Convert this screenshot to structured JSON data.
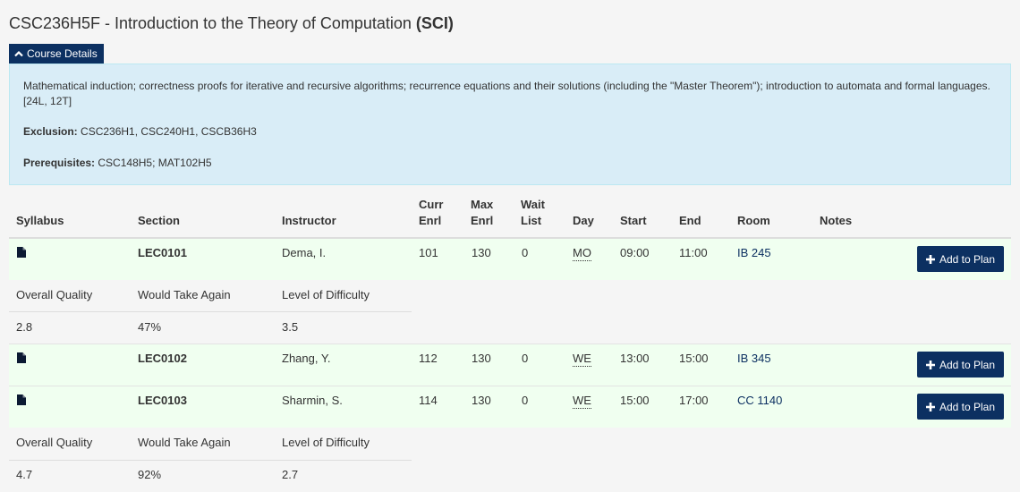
{
  "course": {
    "code_title": "CSC236H5F - Introduction to the Theory of Computation",
    "category": "(SCI)",
    "details_toggle": "Course Details",
    "description": "Mathematical induction; correctness proofs for iterative and recursive algorithms; recurrence equations and their solutions (including the \"Master Theorem\"); introduction to automata and formal languages. [24L, 12T]",
    "exclusion_label": "Exclusion:",
    "exclusion_value": " CSC236H1, CSC240H1, CSCB36H3",
    "prereq_label": "Prerequisites:",
    "prereq_value": " CSC148H5; MAT102H5"
  },
  "table": {
    "headers": {
      "syllabus": "Syllabus",
      "section": "Section",
      "instructor": "Instructor",
      "curr1": "Curr",
      "curr2": "Enrl",
      "max1": "Max",
      "max2": "Enrl",
      "wait1": "Wait",
      "wait2": "List",
      "day": "Day",
      "start": "Start",
      "end": "End",
      "room": "Room",
      "notes": "Notes"
    },
    "add_label": "Add to Plan",
    "rows": [
      {
        "section": "LEC0101",
        "instructor": "Dema, I.",
        "curr": "101",
        "max": "130",
        "wait": "0",
        "day": "MO",
        "start": "09:00",
        "end": "11:00",
        "room": "IB 245"
      },
      {
        "section": "LEC0102",
        "instructor": "Zhang, Y.",
        "curr": "112",
        "max": "130",
        "wait": "0",
        "day": "WE",
        "start": "13:00",
        "end": "15:00",
        "room": "IB 345"
      },
      {
        "section": "LEC0103",
        "instructor": "Sharmin, S.",
        "curr": "114",
        "max": "130",
        "wait": "0",
        "day": "WE",
        "start": "15:00",
        "end": "17:00",
        "room": "CC 1140"
      }
    ],
    "rating_headers": {
      "quality": "Overall Quality",
      "again": "Would Take Again",
      "difficulty": "Level of Difficulty"
    },
    "ratings": [
      {
        "quality": "2.8",
        "again": "47%",
        "difficulty": "3.5"
      },
      {
        "quality": "4.7",
        "again": "92%",
        "difficulty": "2.7"
      }
    ]
  },
  "icons": [
    "chevron-up-icon",
    "file-icon",
    "plus-icon"
  ],
  "colors": {
    "primary": "#0c3061",
    "info_bg": "#d9edf7",
    "row_bg": "#f0fff0"
  }
}
